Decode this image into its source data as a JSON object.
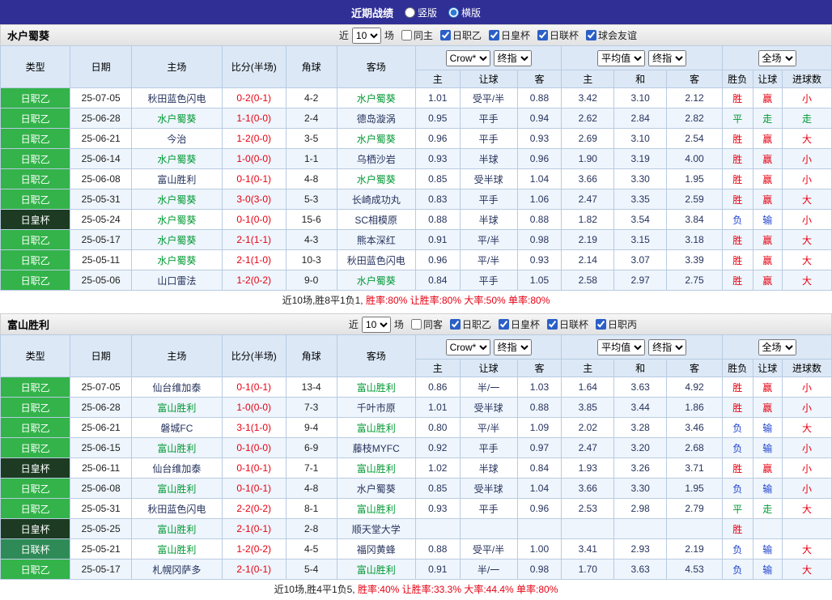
{
  "topbar": {
    "title": "近期战绩",
    "options": [
      {
        "label": "竖版",
        "selected": false
      },
      {
        "label": "横版",
        "selected": true
      }
    ]
  },
  "colors": {
    "topbar_bg": "#2f2f96",
    "header_bg": "#dce8f6",
    "alt_row_bg": "#eef5fc",
    "league_j2_green": "#33b34a",
    "league_emperor_dark": "#1c3b22",
    "league_levain_green": "#2e8b57",
    "win_red": "#e60012",
    "draw_green": "#009933",
    "lose_blue": "#1f43cc",
    "team_green": "#009933",
    "score_red": "#e60012"
  },
  "header": {
    "main_cols": [
      "类型",
      "日期",
      "主场",
      "比分(半场)",
      "角球",
      "客场"
    ],
    "bookmaker_select": "Crow*",
    "odds_period_select": "终指",
    "average_select": "平均值",
    "avg_period_select": "终指",
    "scope_select": "全场",
    "odds_sub": [
      "主",
      "让球",
      "客"
    ],
    "avg_sub": [
      "主",
      "和",
      "客"
    ],
    "result_sub": [
      "胜负",
      "让球",
      "进球数"
    ]
  },
  "sections": [
    {
      "team": "水户蜀葵",
      "filters": {
        "near": "近",
        "count": "10",
        "unit": "场",
        "venue": {
          "label": "同主",
          "checked": false
        },
        "leagues": [
          {
            "label": "日职乙",
            "checked": true
          },
          {
            "label": "日皇杯",
            "checked": true
          },
          {
            "label": "日联杯",
            "checked": true
          },
          {
            "label": "球会友谊",
            "checked": true
          }
        ]
      },
      "rows": [
        {
          "league": "日职乙",
          "league_key": "j2",
          "date": "25-07-05",
          "home": "秋田蓝色闪电",
          "home_team": false,
          "score": "0-2(0-1)",
          "corner": "4-2",
          "away": "水户蜀葵",
          "away_team": true,
          "odds": [
            "1.01",
            "受平/半",
            "0.88"
          ],
          "avg": [
            "3.42",
            "3.10",
            "2.12"
          ],
          "results": [
            {
              "t": "胜",
              "c": "r"
            },
            {
              "t": "赢",
              "c": "r"
            },
            {
              "t": "小",
              "c": "r"
            }
          ]
        },
        {
          "league": "日职乙",
          "league_key": "j2",
          "date": "25-06-28",
          "home": "水户蜀葵",
          "home_team": true,
          "score": "1-1(0-0)",
          "corner": "2-4",
          "away": "德岛漩涡",
          "away_team": false,
          "odds": [
            "0.95",
            "平手",
            "0.94"
          ],
          "avg": [
            "2.62",
            "2.84",
            "2.82"
          ],
          "results": [
            {
              "t": "平",
              "c": "g"
            },
            {
              "t": "走",
              "c": "g"
            },
            {
              "t": "走",
              "c": "g"
            }
          ]
        },
        {
          "league": "日职乙",
          "league_key": "j2",
          "date": "25-06-21",
          "home": "今治",
          "home_team": false,
          "score": "1-2(0-0)",
          "corner": "3-5",
          "away": "水户蜀葵",
          "away_team": true,
          "odds": [
            "0.96",
            "平手",
            "0.93"
          ],
          "avg": [
            "2.69",
            "3.10",
            "2.54"
          ],
          "results": [
            {
              "t": "胜",
              "c": "r"
            },
            {
              "t": "赢",
              "c": "r"
            },
            {
              "t": "大",
              "c": "r"
            }
          ]
        },
        {
          "league": "日职乙",
          "league_key": "j2",
          "date": "25-06-14",
          "home": "水户蜀葵",
          "home_team": true,
          "score": "1-0(0-0)",
          "corner": "1-1",
          "away": "乌栖沙岩",
          "away_team": false,
          "odds": [
            "0.93",
            "半球",
            "0.96"
          ],
          "avg": [
            "1.90",
            "3.19",
            "4.00"
          ],
          "results": [
            {
              "t": "胜",
              "c": "r"
            },
            {
              "t": "赢",
              "c": "r"
            },
            {
              "t": "小",
              "c": "r"
            }
          ]
        },
        {
          "league": "日职乙",
          "league_key": "j2",
          "date": "25-06-08",
          "home": "富山胜利",
          "home_team": false,
          "score": "0-1(0-1)",
          "corner": "4-8",
          "away": "水户蜀葵",
          "away_team": true,
          "odds": [
            "0.85",
            "受半球",
            "1.04"
          ],
          "avg": [
            "3.66",
            "3.30",
            "1.95"
          ],
          "results": [
            {
              "t": "胜",
              "c": "r"
            },
            {
              "t": "赢",
              "c": "r"
            },
            {
              "t": "小",
              "c": "r"
            }
          ]
        },
        {
          "league": "日职乙",
          "league_key": "j2",
          "date": "25-05-31",
          "home": "水户蜀葵",
          "home_team": true,
          "score": "3-0(3-0)",
          "corner": "5-3",
          "away": "长崎成功丸",
          "away_team": false,
          "odds": [
            "0.83",
            "平手",
            "1.06"
          ],
          "avg": [
            "2.47",
            "3.35",
            "2.59"
          ],
          "results": [
            {
              "t": "胜",
              "c": "r"
            },
            {
              "t": "赢",
              "c": "r"
            },
            {
              "t": "大",
              "c": "r"
            }
          ]
        },
        {
          "league": "日皇杯",
          "league_key": "emp",
          "date": "25-05-24",
          "home": "水户蜀葵",
          "home_team": true,
          "score": "0-1(0-0)",
          "corner": "15-6",
          "away": "SC相模原",
          "away_team": false,
          "odds": [
            "0.88",
            "半球",
            "0.88"
          ],
          "avg": [
            "1.82",
            "3.54",
            "3.84"
          ],
          "results": [
            {
              "t": "负",
              "c": "b"
            },
            {
              "t": "输",
              "c": "b"
            },
            {
              "t": "小",
              "c": "r"
            }
          ]
        },
        {
          "league": "日职乙",
          "league_key": "j2",
          "date": "25-05-17",
          "home": "水户蜀葵",
          "home_team": true,
          "score": "2-1(1-1)",
          "corner": "4-3",
          "away": "熊本深红",
          "away_team": false,
          "odds": [
            "0.91",
            "平/半",
            "0.98"
          ],
          "avg": [
            "2.19",
            "3.15",
            "3.18"
          ],
          "results": [
            {
              "t": "胜",
              "c": "r"
            },
            {
              "t": "赢",
              "c": "r"
            },
            {
              "t": "大",
              "c": "r"
            }
          ]
        },
        {
          "league": "日职乙",
          "league_key": "j2",
          "date": "25-05-11",
          "home": "水户蜀葵",
          "home_team": true,
          "score": "2-1(1-0)",
          "corner": "10-3",
          "away": "秋田蓝色闪电",
          "away_team": false,
          "odds": [
            "0.96",
            "平/半",
            "0.93"
          ],
          "avg": [
            "2.14",
            "3.07",
            "3.39"
          ],
          "results": [
            {
              "t": "胜",
              "c": "r"
            },
            {
              "t": "赢",
              "c": "r"
            },
            {
              "t": "大",
              "c": "r"
            }
          ]
        },
        {
          "league": "日职乙",
          "league_key": "j2",
          "date": "25-05-06",
          "home": "山口雷法",
          "home_team": false,
          "score": "1-2(0-2)",
          "corner": "9-0",
          "away": "水户蜀葵",
          "away_team": true,
          "odds": [
            "0.84",
            "平手",
            "1.05"
          ],
          "avg": [
            "2.58",
            "2.97",
            "2.75"
          ],
          "results": [
            {
              "t": "胜",
              "c": "r"
            },
            {
              "t": "赢",
              "c": "r"
            },
            {
              "t": "大",
              "c": "r"
            }
          ]
        }
      ],
      "summary": {
        "prefix": "近10场,胜8平1负1,",
        "stats": "胜率:80% 让胜率:80% 大率:50% 单率:80%"
      }
    },
    {
      "team": "富山胜利",
      "filters": {
        "near": "近",
        "count": "10",
        "unit": "场",
        "venue": {
          "label": "同客",
          "checked": false
        },
        "leagues": [
          {
            "label": "日职乙",
            "checked": true
          },
          {
            "label": "日皇杯",
            "checked": true
          },
          {
            "label": "日联杯",
            "checked": true
          },
          {
            "label": "日职丙",
            "checked": true
          }
        ]
      },
      "rows": [
        {
          "league": "日职乙",
          "league_key": "j2",
          "date": "25-07-05",
          "home": "仙台维加泰",
          "home_team": false,
          "score": "0-1(0-1)",
          "corner": "13-4",
          "away": "富山胜利",
          "away_team": true,
          "odds": [
            "0.86",
            "半/一",
            "1.03"
          ],
          "avg": [
            "1.64",
            "3.63",
            "4.92"
          ],
          "results": [
            {
              "t": "胜",
              "c": "r"
            },
            {
              "t": "赢",
              "c": "r"
            },
            {
              "t": "小",
              "c": "r"
            }
          ]
        },
        {
          "league": "日职乙",
          "league_key": "j2",
          "date": "25-06-28",
          "home": "富山胜利",
          "home_team": true,
          "score": "1-0(0-0)",
          "corner": "7-3",
          "away": "千叶市原",
          "away_team": false,
          "odds": [
            "1.01",
            "受半球",
            "0.88"
          ],
          "avg": [
            "3.85",
            "3.44",
            "1.86"
          ],
          "results": [
            {
              "t": "胜",
              "c": "r"
            },
            {
              "t": "赢",
              "c": "r"
            },
            {
              "t": "小",
              "c": "r"
            }
          ]
        },
        {
          "league": "日职乙",
          "league_key": "j2",
          "date": "25-06-21",
          "home": "磐城FC",
          "home_team": false,
          "score": "3-1(1-0)",
          "corner": "9-4",
          "away": "富山胜利",
          "away_team": true,
          "odds": [
            "0.80",
            "平/半",
            "1.09"
          ],
          "avg": [
            "2.02",
            "3.28",
            "3.46"
          ],
          "results": [
            {
              "t": "负",
              "c": "b"
            },
            {
              "t": "输",
              "c": "b"
            },
            {
              "t": "大",
              "c": "r"
            }
          ]
        },
        {
          "league": "日职乙",
          "league_key": "j2",
          "date": "25-06-15",
          "home": "富山胜利",
          "home_team": true,
          "score": "0-1(0-0)",
          "corner": "6-9",
          "away": "藤枝MYFC",
          "away_team": false,
          "odds": [
            "0.92",
            "平手",
            "0.97"
          ],
          "avg": [
            "2.47",
            "3.20",
            "2.68"
          ],
          "results": [
            {
              "t": "负",
              "c": "b"
            },
            {
              "t": "输",
              "c": "b"
            },
            {
              "t": "小",
              "c": "r"
            }
          ]
        },
        {
          "league": "日皇杯",
          "league_key": "emp",
          "date": "25-06-11",
          "home": "仙台维加泰",
          "home_team": false,
          "score": "0-1(0-1)",
          "corner": "7-1",
          "away": "富山胜利",
          "away_team": true,
          "odds": [
            "1.02",
            "半球",
            "0.84"
          ],
          "avg": [
            "1.93",
            "3.26",
            "3.71"
          ],
          "results": [
            {
              "t": "胜",
              "c": "r"
            },
            {
              "t": "赢",
              "c": "r"
            },
            {
              "t": "小",
              "c": "r"
            }
          ]
        },
        {
          "league": "日职乙",
          "league_key": "j2",
          "date": "25-06-08",
          "home": "富山胜利",
          "home_team": true,
          "score": "0-1(0-1)",
          "corner": "4-8",
          "away": "水户蜀葵",
          "away_team": false,
          "odds": [
            "0.85",
            "受半球",
            "1.04"
          ],
          "avg": [
            "3.66",
            "3.30",
            "1.95"
          ],
          "results": [
            {
              "t": "负",
              "c": "b"
            },
            {
              "t": "输",
              "c": "b"
            },
            {
              "t": "小",
              "c": "r"
            }
          ]
        },
        {
          "league": "日职乙",
          "league_key": "j2",
          "date": "25-05-31",
          "home": "秋田蓝色闪电",
          "home_team": false,
          "score": "2-2(0-2)",
          "corner": "8-1",
          "away": "富山胜利",
          "away_team": true,
          "odds": [
            "0.93",
            "平手",
            "0.96"
          ],
          "avg": [
            "2.53",
            "2.98",
            "2.79"
          ],
          "results": [
            {
              "t": "平",
              "c": "g"
            },
            {
              "t": "走",
              "c": "g"
            },
            {
              "t": "大",
              "c": "r"
            }
          ]
        },
        {
          "league": "日皇杯",
          "league_key": "emp",
          "date": "25-05-25",
          "home": "富山胜利",
          "home_team": true,
          "score": "2-1(0-1)",
          "corner": "2-8",
          "away": "顺天堂大学",
          "away_team": false,
          "odds": [
            "",
            "",
            ""
          ],
          "avg": [
            "",
            "",
            ""
          ],
          "results": [
            {
              "t": "胜",
              "c": "r"
            },
            {
              "t": "",
              "c": "r"
            },
            {
              "t": "",
              "c": "r"
            }
          ]
        },
        {
          "league": "日联杯",
          "league_key": "lev",
          "date": "25-05-21",
          "home": "富山胜利",
          "home_team": true,
          "score": "1-2(0-2)",
          "corner": "4-5",
          "away": "福冈黄蜂",
          "away_team": false,
          "odds": [
            "0.88",
            "受平/半",
            "1.00"
          ],
          "avg": [
            "3.41",
            "2.93",
            "2.19"
          ],
          "results": [
            {
              "t": "负",
              "c": "b"
            },
            {
              "t": "输",
              "c": "b"
            },
            {
              "t": "大",
              "c": "r"
            }
          ]
        },
        {
          "league": "日职乙",
          "league_key": "j2",
          "date": "25-05-17",
          "home": "札幌冈萨多",
          "home_team": false,
          "score": "2-1(0-1)",
          "corner": "5-4",
          "away": "富山胜利",
          "away_team": true,
          "odds": [
            "0.91",
            "半/一",
            "0.98"
          ],
          "avg": [
            "1.70",
            "3.63",
            "4.53"
          ],
          "results": [
            {
              "t": "负",
              "c": "b"
            },
            {
              "t": "输",
              "c": "b"
            },
            {
              "t": "大",
              "c": "r"
            }
          ]
        }
      ],
      "summary": {
        "prefix": "近10场,胜4平1负5,",
        "stats": "胜率:40% 让胜率:33.3% 大率:44.4% 单率:80%"
      }
    }
  ]
}
